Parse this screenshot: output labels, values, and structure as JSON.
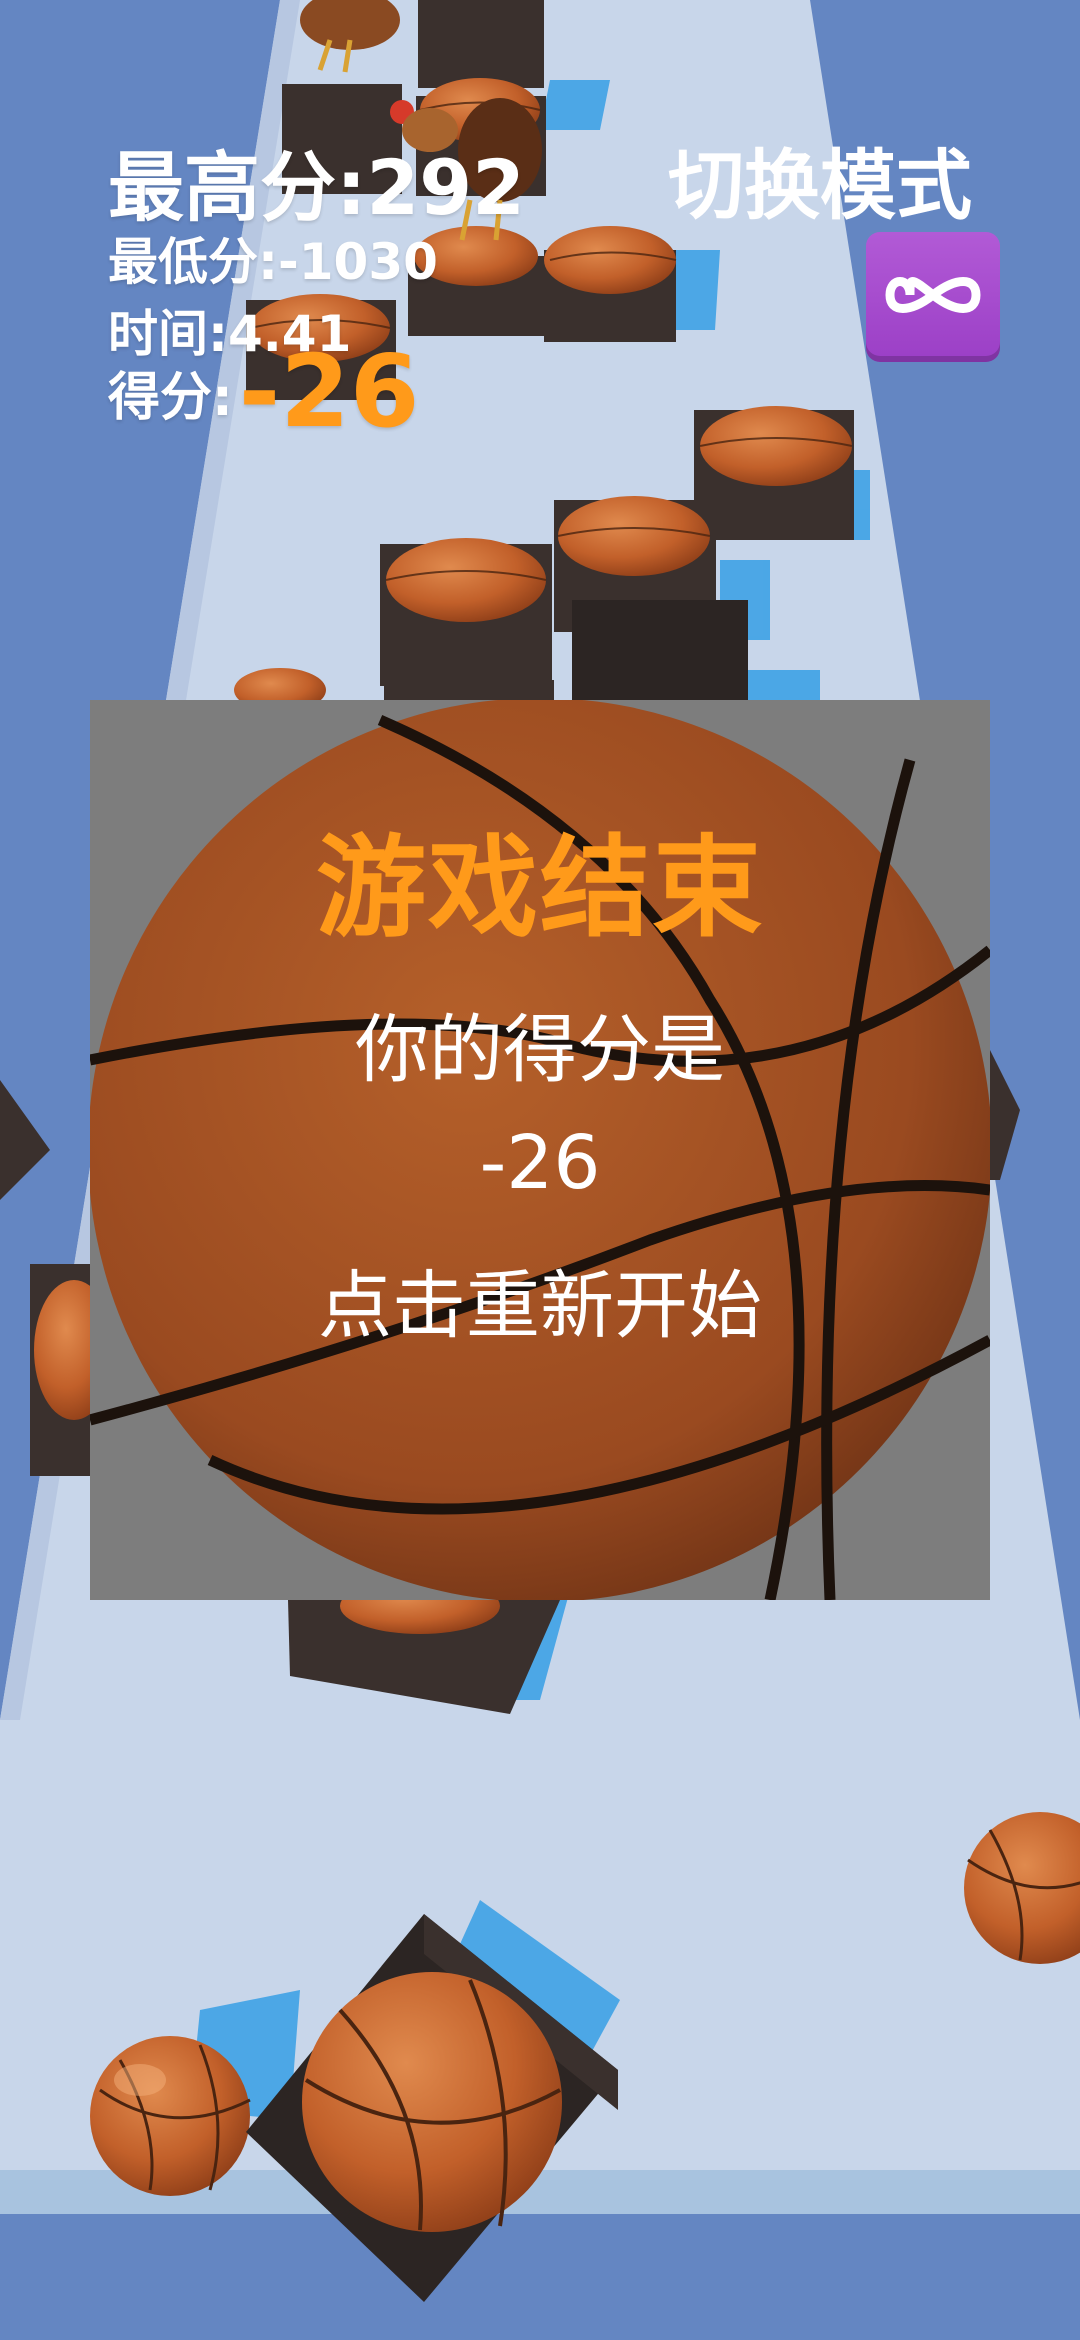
{
  "hud": {
    "best_label": "最高分:",
    "best_value": "292",
    "min_label": "最低分:",
    "min_value": "-1030",
    "time_label": "时间:",
    "time_value": "4.41",
    "score_label": "得分:",
    "score_value": "-26",
    "mode_label": "切换模式",
    "mode_icon": "infinity-icon"
  },
  "game_over": {
    "title": "游戏结束",
    "score_label": "你的得分是",
    "score_value": "-26",
    "restart_label": "点击重新开始"
  },
  "colors": {
    "accent_orange": "#ff9a1a",
    "track": "#c8d6ea",
    "side": "#6486c2",
    "block": "#3a302d",
    "ball": "#c2602a",
    "overlay": "#7d7d7d",
    "mode_button": "#a64ccf"
  },
  "scene_objects": [
    "rooster-icon",
    "basketball-block-icon",
    "basketball-icon"
  ]
}
